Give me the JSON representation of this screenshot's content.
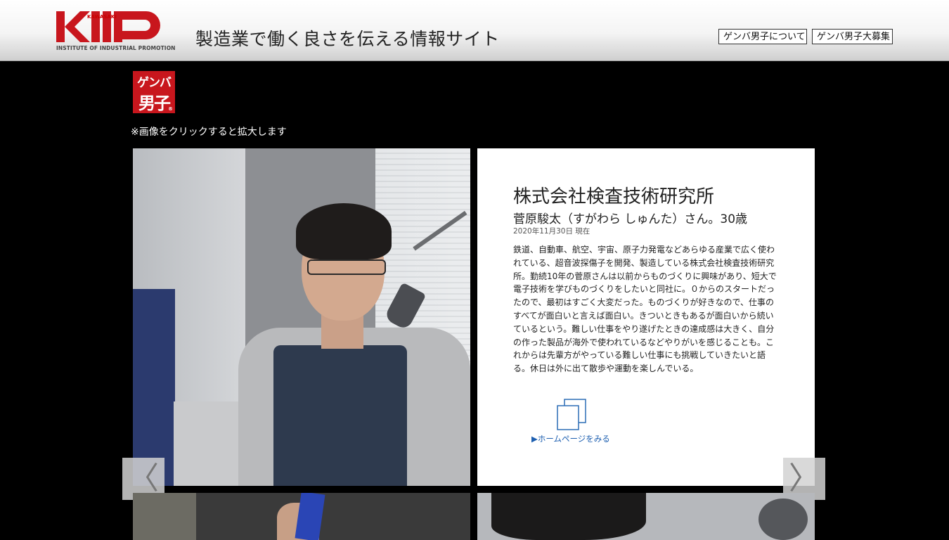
{
  "header": {
    "logo_text": "KIIP",
    "logo_kawasaki": "KAWASAKI",
    "logo_sub": "INSTITUTE OF INDUSTRIAL PROMOTION",
    "site_title": "製造業で働く良さを伝える情報サイト",
    "btn_about": "ゲンバ男子について",
    "btn_recruit": "ゲンバ男子大募集",
    "brand_color": "#c8161d"
  },
  "badge": {
    "line1": "ゲンバ",
    "line2": "男子",
    "reg": "®"
  },
  "note": "※画像をクリックすると拡大します",
  "profile": {
    "company": "株式会社検査技術研究所",
    "person": "菅原駿太（すがわら しゅんた）さん。30歳",
    "date": "2020年11月30日 現在",
    "description": "鉄道、自動車、航空、宇宙、原子力発電などあらゆる産業で広く使われている、超音波探傷子を開発、製造している株式会社検査技術研究所。勤続10年の菅原さんは以前からものづくりに興味があり、短大で電子技術を学びものづくりをしたいと同社に。０からのスタートだったので、最初はすごく大変だった。ものづくりが好きなので、仕事のすべてが面白いと言えば面白い。きついときもあるが面白いから続いているという。難しい仕事をやり遂げたときの達成感は大きく、自分の作った製品が海外で使われているなどやりがいを感じることも。これからは先輩方がやっている難しい仕事にも挑戦していきたいと語る。休日は外に出て散歩や運動を楽しんでいる。",
    "homepage_link": "▶ホームページをみる",
    "link_color": "#1d5fb0"
  },
  "nav": {
    "prev_glyph": "〈",
    "next_glyph": "〉"
  },
  "icons": {
    "homepage": "external-window-icon"
  }
}
